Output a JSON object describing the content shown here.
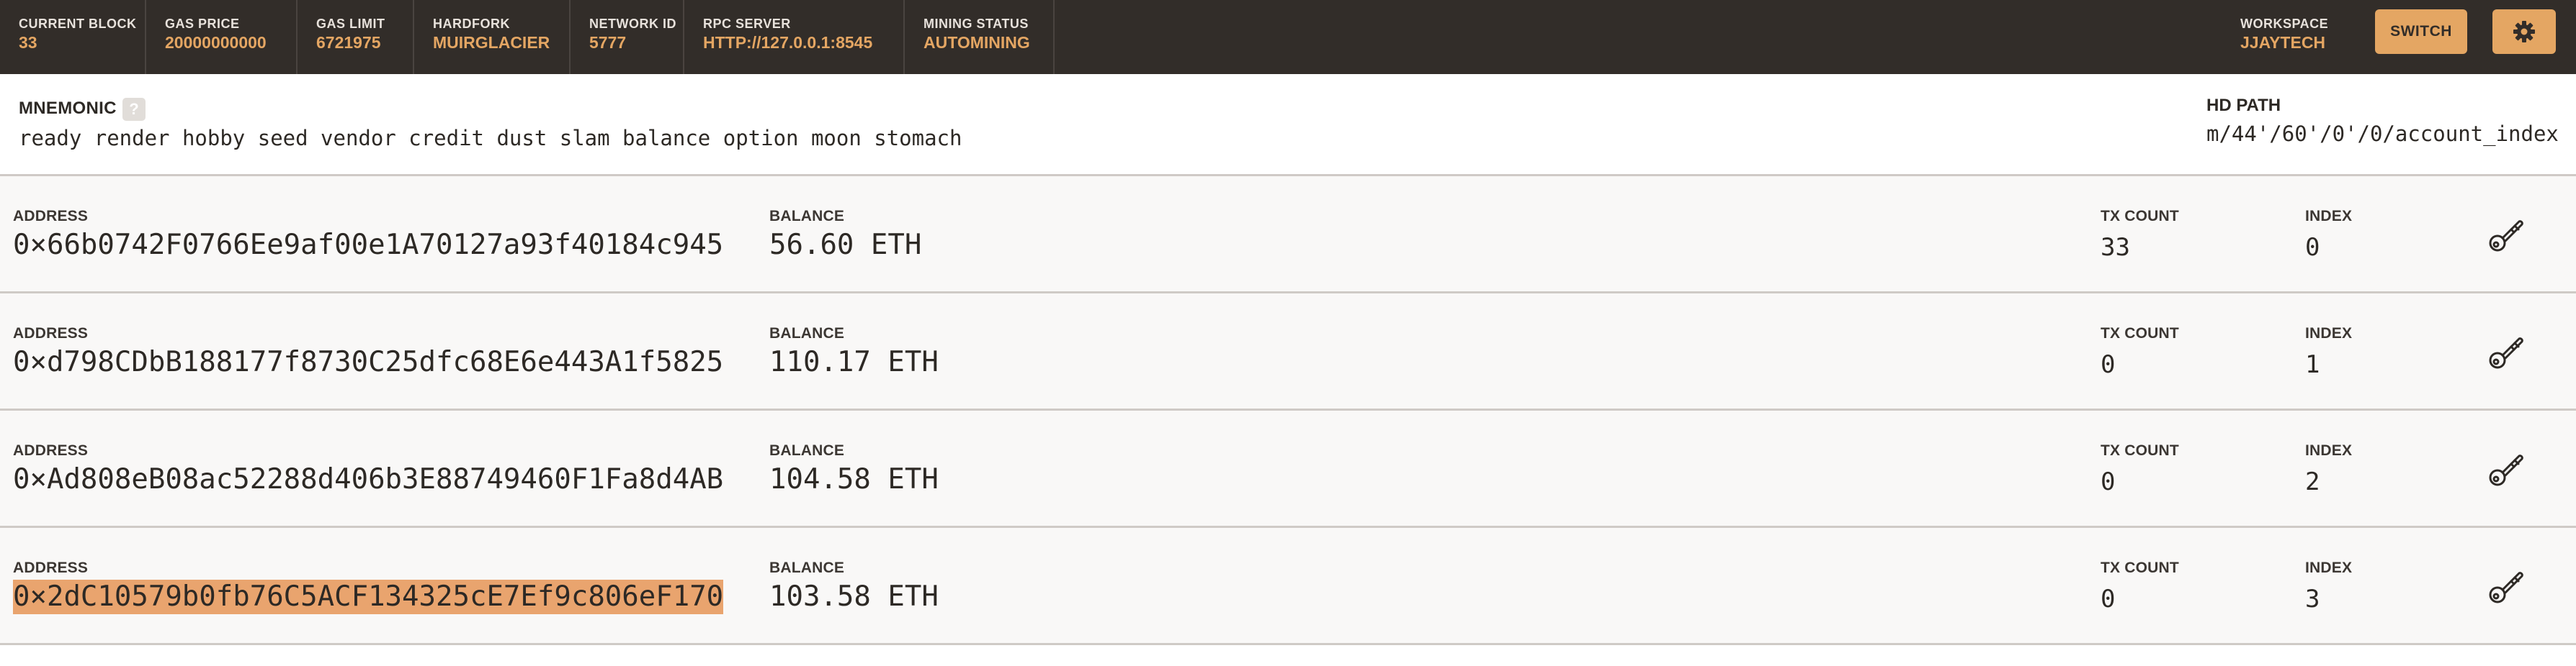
{
  "header": {
    "stats": [
      {
        "label": "CURRENT BLOCK",
        "value": "33"
      },
      {
        "label": "GAS PRICE",
        "value": "20000000000"
      },
      {
        "label": "GAS LIMIT",
        "value": "6721975"
      },
      {
        "label": "HARDFORK",
        "value": "MUIRGLACIER"
      },
      {
        "label": "NETWORK ID",
        "value": "5777"
      },
      {
        "label": "RPC SERVER",
        "value": "HTTP://127.0.0.1:8545"
      },
      {
        "label": "MINING STATUS",
        "value": "AUTOMINING"
      }
    ],
    "workspace_label": "WORKSPACE",
    "workspace_value": "JJAYTECH",
    "switch_label": "SWITCH",
    "settings_icon": "gear-icon"
  },
  "mnemonic": {
    "label": "MNEMONIC",
    "help": "?",
    "words": "ready render hobby seed vendor credit dust slam balance option moon stomach",
    "hd_path_label": "HD PATH",
    "hd_path_value": "m/44'/60'/0'/0/account_index"
  },
  "accounts": [
    {
      "address_label": "ADDRESS",
      "address": "0×66b0742F0766Ee9af00e1A70127a93f40184c945",
      "balance_label": "BALANCE",
      "balance": "56.60 ETH",
      "tx_count_label": "TX COUNT",
      "tx_count": "33",
      "index_label": "INDEX",
      "index": "0"
    },
    {
      "address_label": "ADDRESS",
      "address": "0×d798CDbB188177f8730C25dfc68E6e443A1f5825",
      "balance_label": "BALANCE",
      "balance": "110.17 ETH",
      "tx_count_label": "TX COUNT",
      "tx_count": "0",
      "index_label": "INDEX",
      "index": "1"
    },
    {
      "address_label": "ADDRESS",
      "address": "0×Ad808eB08ac52288d406b3E88749460F1Fa8d4AB",
      "balance_label": "BALANCE",
      "balance": "104.58 ETH",
      "tx_count_label": "TX COUNT",
      "tx_count": "0",
      "index_label": "INDEX",
      "index": "2"
    },
    {
      "address_label": "ADDRESS",
      "address": "0×2dC10579b0fb76C5ACF134325cE7Ef9c806eF170",
      "balance_label": "BALANCE",
      "balance": "103.58 ETH",
      "tx_count_label": "TX COUNT",
      "tx_count": "0",
      "index_label": "INDEX",
      "index": "3"
    }
  ],
  "colors": {
    "header_bg": "#322d29",
    "accent": "#e4a663",
    "selection": "#e9a46e"
  }
}
